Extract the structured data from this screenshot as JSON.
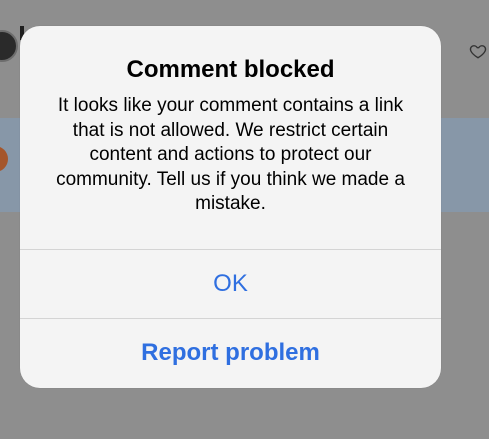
{
  "dialog": {
    "title": "Comment blocked",
    "message": "It looks like your comment contains a link that is not allowed. We restrict certain content and actions to protect our community. Tell us if you think we made a mistake.",
    "buttons": {
      "ok": "OK",
      "report": "Report problem"
    }
  },
  "background": {
    "icons": [
      "avatar",
      "heart-icon"
    ]
  },
  "colors": {
    "accent": "#2f6fe0",
    "dialog_bg": "#f4f4f4",
    "overlay": "#8e8e8e"
  }
}
